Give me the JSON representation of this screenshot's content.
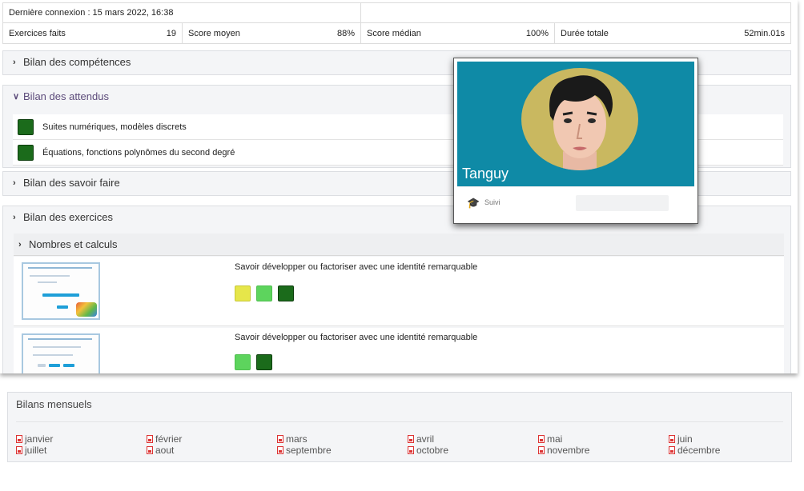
{
  "stats": {
    "last_login": "Dernière connexion : 15 mars 2022, 16:38",
    "items": [
      {
        "label": "Exercices faits",
        "value": "19"
      },
      {
        "label": "Score moyen",
        "value": "88%"
      },
      {
        "label": "Score médian",
        "value": "100%"
      },
      {
        "label": "Durée totale",
        "value": "52min.01s"
      }
    ]
  },
  "panels": {
    "competences": "Bilan des compétences",
    "attendus": "Bilan des attendus",
    "savoir_faire": "Bilan des savoir faire",
    "exercices": "Bilan des exercices"
  },
  "attendus": [
    {
      "label": "Suites numériques, modèles discrets",
      "status": "dark"
    },
    {
      "label": "Équations, fonctions polynômes du second degré",
      "status": "dark"
    }
  ],
  "exercices_section": {
    "title": "Nombres et calculs",
    "items": [
      {
        "title": "Savoir développer ou factoriser avec une identité remarquable",
        "scores": [
          "yellow",
          "light",
          "dark"
        ]
      },
      {
        "title": "Savoir développer ou factoriser avec une identité remarquable",
        "scores": [
          "light",
          "dark"
        ]
      }
    ]
  },
  "profile_card": {
    "name": "Tanguy",
    "role": "Suivi",
    "icon": "graduation-cap-icon",
    "header_color": "#0f8aa6"
  },
  "monthly": {
    "title": "Bilans mensuels",
    "months": [
      "janvier",
      "février",
      "mars",
      "avril",
      "mai",
      "juin",
      "juillet",
      "aout",
      "septembre",
      "octobre",
      "novembre",
      "décembre"
    ]
  },
  "colors": {
    "dark_green": "#1b6b1b",
    "light_green": "#5dd45d",
    "yellow": "#e6e64a"
  }
}
